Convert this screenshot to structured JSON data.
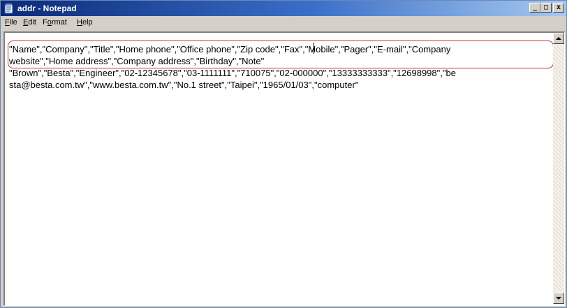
{
  "window": {
    "title": "addr - Notepad",
    "controls": {
      "minimize": "_",
      "maximize": "□",
      "close": "x"
    }
  },
  "menubar": {
    "items": [
      {
        "label": "File",
        "mnemonic": "F",
        "rest": "ile"
      },
      {
        "label": "Edit",
        "mnemonic": "E",
        "rest": "dit"
      },
      {
        "label": "Format",
        "lead": "F",
        "mnemonic": "o",
        "rest": "rmat"
      },
      {
        "label": "Help",
        "mnemonic": "H",
        "rest": "elp"
      }
    ]
  },
  "document": {
    "lines": [
      "\"Name\",\"Company\",\"Title\",\"Home phone\",\"Office phone\",\"Zip code\",\"Fax\",\"Mobile\",\"Pager\",\"E-mail\",\"Company",
      "website\",\"Home address\",\"Company address\",\"Birthday\",\"Note\"",
      "\"Brown\",\"Besta\",\"Engineer\",\"02-12345678\",\"03-1111111\",\"710075\",\"02-000000\",\"13333333333\",\"12698998\",\"be",
      "sta@besta.com.tw\",\"www.besta.com.tw\",\"No.1 street\",\"Taipei\",\"1965/01/03\",\"computer\""
    ]
  },
  "colors": {
    "title_start": "#0a2a78",
    "title_end": "#a6caf0",
    "highlight": "#c2343a"
  }
}
